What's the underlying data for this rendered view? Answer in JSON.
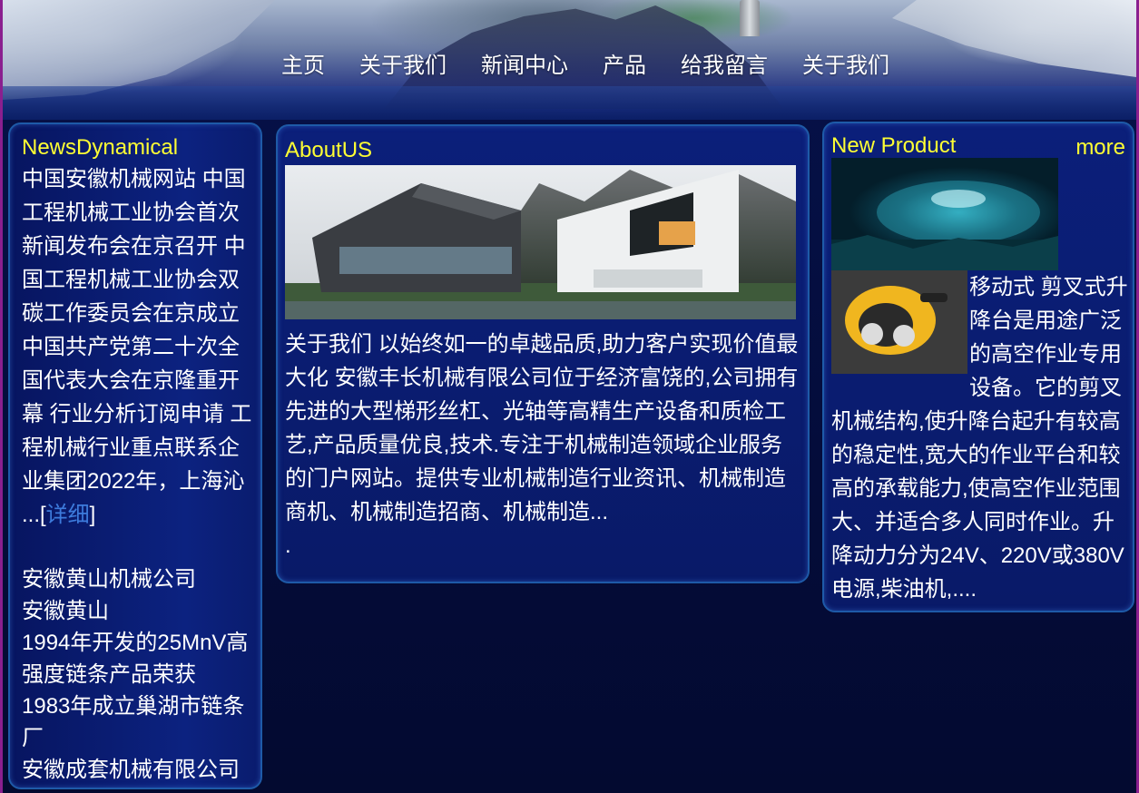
{
  "nav": {
    "items": [
      "主页",
      "关于我们",
      "新闻中心",
      "产品",
      "给我留言",
      "关于我们"
    ]
  },
  "news": {
    "title": "NewsDynamical",
    "body": " 中国安徽机械网站 中国工程机械工业协会首次新闻发布会在京召开 中国工程机械工业协会双碳工作委员会在京成立 中国共产党第二十次全国代表大会在京隆重开幕 行业分析订阅申请 工程机械行业重点联系企业集团2022年，上海沁 ...[",
    "detail_link": "详细",
    "bracket_close": "]",
    "list": [
      "安徽黄山机械公司",
      "安徽黄山",
      "1994年开发的25MnV高强度链条产品荣获",
      "1983年成立巢湖市链条厂",
      "安徽成套机械有限公司"
    ]
  },
  "about": {
    "title": "AboutUS",
    "text": " 关于我们 以始终如一的卓越品质,助力客户实现价值最大化 安徽丰长机械有限公司位于经济富饶的,公司拥有先进的大型梯形丝杠、光轴等高精生产设备和质检工艺,产品质量优良,技术.专注于机械制造领域企业服务的门户网站。提供专业机械制造行业资讯、机械制造商机、机械制造招商、机械制造...",
    "trailing": "."
  },
  "product": {
    "title": "New Product",
    "more": "more",
    "text": " 移动式 剪叉式升降台是用途广泛的高空作业专用设备。它的剪叉机械结构,使升降台起升有较高的稳定性,宽大的作业平台和较高的承载能力,使高空作业范围大、并适合多人同时作业。升降动力分为24V、220V或380V电源,柴油机,...."
  }
}
